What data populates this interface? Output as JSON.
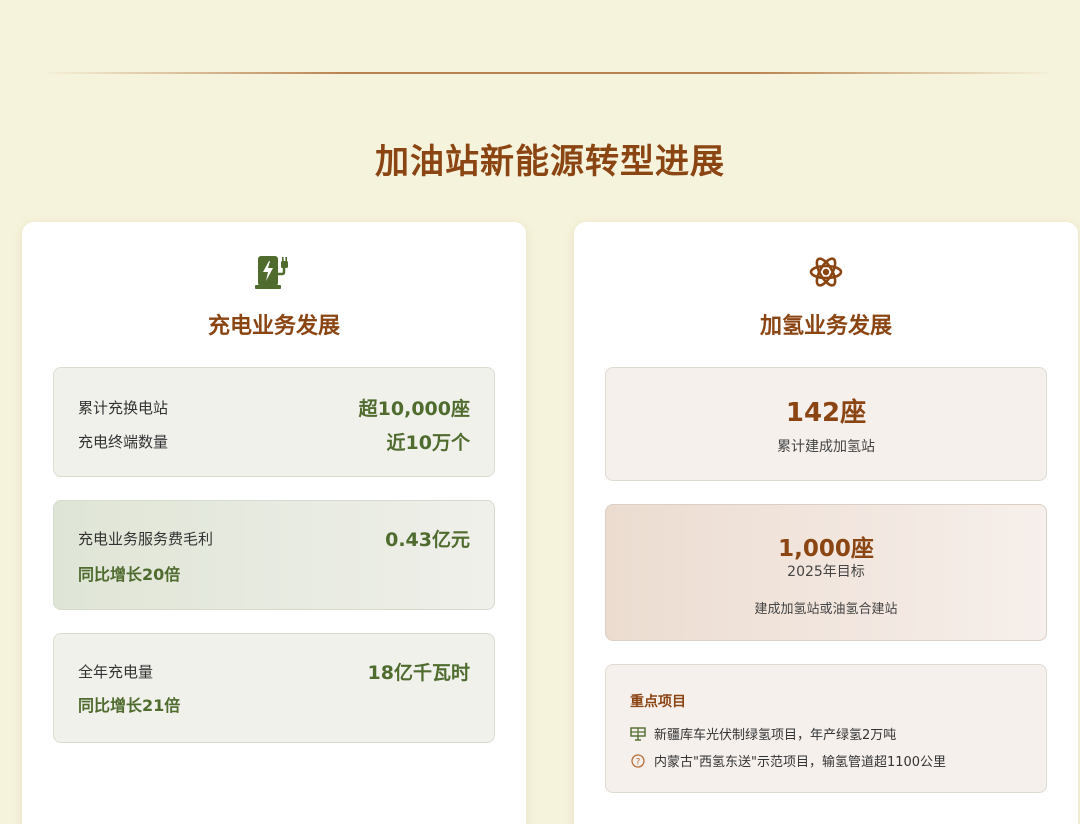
{
  "page": {
    "title": "加油站新能源转型进展"
  },
  "colors": {
    "accent": "#8b4513",
    "green": "#4f6b2e",
    "background": "#f6f3dc"
  },
  "charging": {
    "icon": "ev-charging-station-icon",
    "title": "充电业务发展",
    "stations_label": "累计充换电站",
    "stations_value": "超10,000座",
    "terminals_label": "充电终端数量",
    "terminals_value": "近10万个",
    "profit_label": "充电业务服务费毛利",
    "profit_value": "0.43亿元",
    "profit_growth": "同比增长20倍",
    "energy_label": "全年充电量",
    "energy_value": "18亿千瓦时",
    "energy_growth": "同比增长21倍"
  },
  "hydrogen": {
    "icon": "atom-icon",
    "title": "加氢业务发展",
    "built_value": "142座",
    "built_label": "累计建成加氢站",
    "target_value": "1,000座",
    "target_label": "2025年目标",
    "target_desc": "建成加氢站或油氢合建站",
    "projects_title": "重点项目",
    "projects": [
      {
        "icon": "solar-panel-icon",
        "text": "新疆库车光伏制绿氢项目，年产绿氢2万吨"
      },
      {
        "icon": "question-circle-icon",
        "text": "内蒙古\"西氢东送\"示范项目，输氢管道超1100公里"
      }
    ]
  }
}
